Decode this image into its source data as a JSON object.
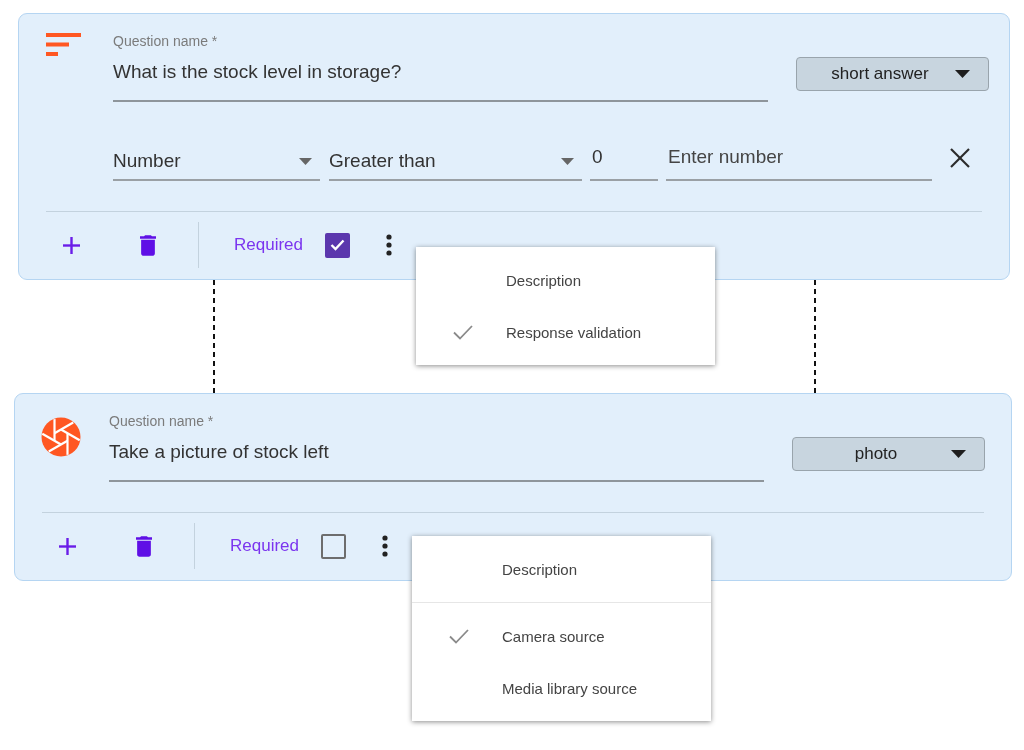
{
  "questions": [
    {
      "kind": "short_answer",
      "name_label": "Question name *",
      "name_value": "What is the stock level in storage?",
      "type": "short answer",
      "validation": {
        "field": "Number",
        "condition": "Greater than",
        "value": "0",
        "placeholder": "Enter number"
      },
      "required_label": "Required",
      "required": true,
      "menu": {
        "sections": [
          {
            "items": [
              {
                "label": "Description",
                "checked": false
              },
              {
                "label": "Response validation",
                "checked": true
              }
            ]
          }
        ]
      }
    },
    {
      "kind": "photo",
      "name_label": "Question name *",
      "name_value": "Take a picture of stock left",
      "type": "photo",
      "required_label": "Required",
      "required": false,
      "menu": {
        "sections": [
          {
            "items": [
              {
                "label": "Description",
                "checked": false
              }
            ]
          },
          {
            "items": [
              {
                "label": "Camera source",
                "checked": true
              },
              {
                "label": "Media library source",
                "checked": false
              }
            ]
          }
        ]
      }
    }
  ]
}
